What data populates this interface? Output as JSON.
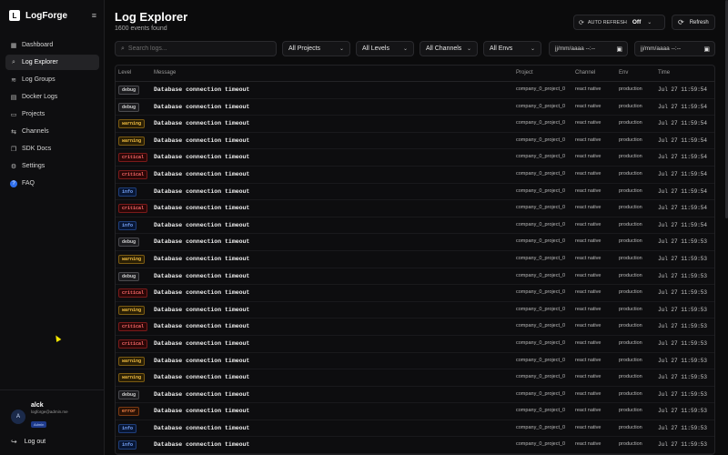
{
  "brand": {
    "logo_letter": "L",
    "name": "LogForge",
    "menu_glyph": "≡"
  },
  "nav": [
    {
      "label": "Dashboard",
      "icon": "▦",
      "active": false
    },
    {
      "label": "Log Explorer",
      "icon": "⌕",
      "active": true
    },
    {
      "label": "Log Groups",
      "icon": "≋",
      "active": false
    },
    {
      "label": "Docker Logs",
      "icon": "▤",
      "active": false
    },
    {
      "label": "Projects",
      "icon": "▭",
      "active": false
    },
    {
      "label": "Channels",
      "icon": "⇆",
      "active": false
    },
    {
      "label": "SDK Docs",
      "icon": "❐",
      "active": false
    },
    {
      "label": "Settings",
      "icon": "⚙",
      "active": false
    },
    {
      "label": "FAQ",
      "icon": "?",
      "active": false
    }
  ],
  "user": {
    "initial": "A",
    "name": "alck",
    "email": "logforge@admin.me",
    "role": "Admin"
  },
  "logout": {
    "label": "Log out",
    "icon": "↪"
  },
  "header": {
    "title": "Log Explorer",
    "subtitle": "1600 events found"
  },
  "auto_refresh": {
    "label": "AUTO REFRESH",
    "value": "Off",
    "icon": "⟳",
    "chevron": "⌄"
  },
  "refresh": {
    "label": "Refresh",
    "icon": "⟳"
  },
  "filters": {
    "search_placeholder": "Search logs...",
    "search_icon": "⌕",
    "projects": "All Projects",
    "levels": "All Levels",
    "channels": "All Channels",
    "envs": "All Envs",
    "date_from": "jj/mm/aaaa --:--",
    "date_to": "jj/mm/aaaa --:--",
    "chevron": "⌄",
    "calendar_icon": "▣"
  },
  "columns": {
    "level": "Level",
    "message": "Message",
    "project": "Project",
    "channel": "Channel",
    "env": "Env",
    "time": "Time"
  },
  "colors": {
    "debug": "#d0d0d0",
    "warning": "#f5c042",
    "critical": "#ff6b6b",
    "info": "#7aa7ff",
    "error": "#ff8a4d",
    "accent": "#2f6fed"
  },
  "rows": [
    {
      "level": "debug",
      "message": "Database connection timeout",
      "project": "company_0_project_0",
      "channel": "react native",
      "env": "production",
      "time": "Jul 27 11:59:54"
    },
    {
      "level": "debug",
      "message": "Database connection timeout",
      "project": "company_0_project_0",
      "channel": "react native",
      "env": "production",
      "time": "Jul 27 11:59:54"
    },
    {
      "level": "warning",
      "message": "Database connection timeout",
      "project": "company_0_project_0",
      "channel": "react native",
      "env": "production",
      "time": "Jul 27 11:59:54"
    },
    {
      "level": "warning",
      "message": "Database connection timeout",
      "project": "company_0_project_0",
      "channel": "react native",
      "env": "production",
      "time": "Jul 27 11:59:54"
    },
    {
      "level": "critical",
      "message": "Database connection timeout",
      "project": "company_0_project_0",
      "channel": "react native",
      "env": "production",
      "time": "Jul 27 11:59:54"
    },
    {
      "level": "critical",
      "message": "Database connection timeout",
      "project": "company_0_project_0",
      "channel": "react native",
      "env": "production",
      "time": "Jul 27 11:59:54"
    },
    {
      "level": "info",
      "message": "Database connection timeout",
      "project": "company_0_project_0",
      "channel": "react native",
      "env": "production",
      "time": "Jul 27 11:59:54"
    },
    {
      "level": "critical",
      "message": "Database connection timeout",
      "project": "company_0_project_0",
      "channel": "react native",
      "env": "production",
      "time": "Jul 27 11:59:54"
    },
    {
      "level": "info",
      "message": "Database connection timeout",
      "project": "company_0_project_0",
      "channel": "react native",
      "env": "production",
      "time": "Jul 27 11:59:54"
    },
    {
      "level": "debug",
      "message": "Database connection timeout",
      "project": "company_0_project_0",
      "channel": "react native",
      "env": "production",
      "time": "Jul 27 11:59:53"
    },
    {
      "level": "warning",
      "message": "Database connection timeout",
      "project": "company_0_project_0",
      "channel": "react native",
      "env": "production",
      "time": "Jul 27 11:59:53"
    },
    {
      "level": "debug",
      "message": "Database connection timeout",
      "project": "company_0_project_0",
      "channel": "react native",
      "env": "production",
      "time": "Jul 27 11:59:53"
    },
    {
      "level": "critical",
      "message": "Database connection timeout",
      "project": "company_0_project_0",
      "channel": "react native",
      "env": "production",
      "time": "Jul 27 11:59:53"
    },
    {
      "level": "warning",
      "message": "Database connection timeout",
      "project": "company_0_project_0",
      "channel": "react native",
      "env": "production",
      "time": "Jul 27 11:59:53"
    },
    {
      "level": "critical",
      "message": "Database connection timeout",
      "project": "company_0_project_0",
      "channel": "react native",
      "env": "production",
      "time": "Jul 27 11:59:53"
    },
    {
      "level": "critical",
      "message": "Database connection timeout",
      "project": "company_0_project_0",
      "channel": "react native",
      "env": "production",
      "time": "Jul 27 11:59:53"
    },
    {
      "level": "warning",
      "message": "Database connection timeout",
      "project": "company_0_project_0",
      "channel": "react native",
      "env": "production",
      "time": "Jul 27 11:59:53"
    },
    {
      "level": "warning",
      "message": "Database connection timeout",
      "project": "company_0_project_0",
      "channel": "react native",
      "env": "production",
      "time": "Jul 27 11:59:53"
    },
    {
      "level": "debug",
      "message": "Database connection timeout",
      "project": "company_0_project_0",
      "channel": "react native",
      "env": "production",
      "time": "Jul 27 11:59:53"
    },
    {
      "level": "error",
      "message": "Database connection timeout",
      "project": "company_0_project_0",
      "channel": "react native",
      "env": "production",
      "time": "Jul 27 11:59:53"
    },
    {
      "level": "info",
      "message": "Database connection timeout",
      "project": "company_0_project_0",
      "channel": "react native",
      "env": "production",
      "time": "Jul 27 11:59:53"
    },
    {
      "level": "info",
      "message": "Database connection timeout",
      "project": "company_0_project_0",
      "channel": "react native",
      "env": "production",
      "time": "Jul 27 11:59:53"
    }
  ]
}
